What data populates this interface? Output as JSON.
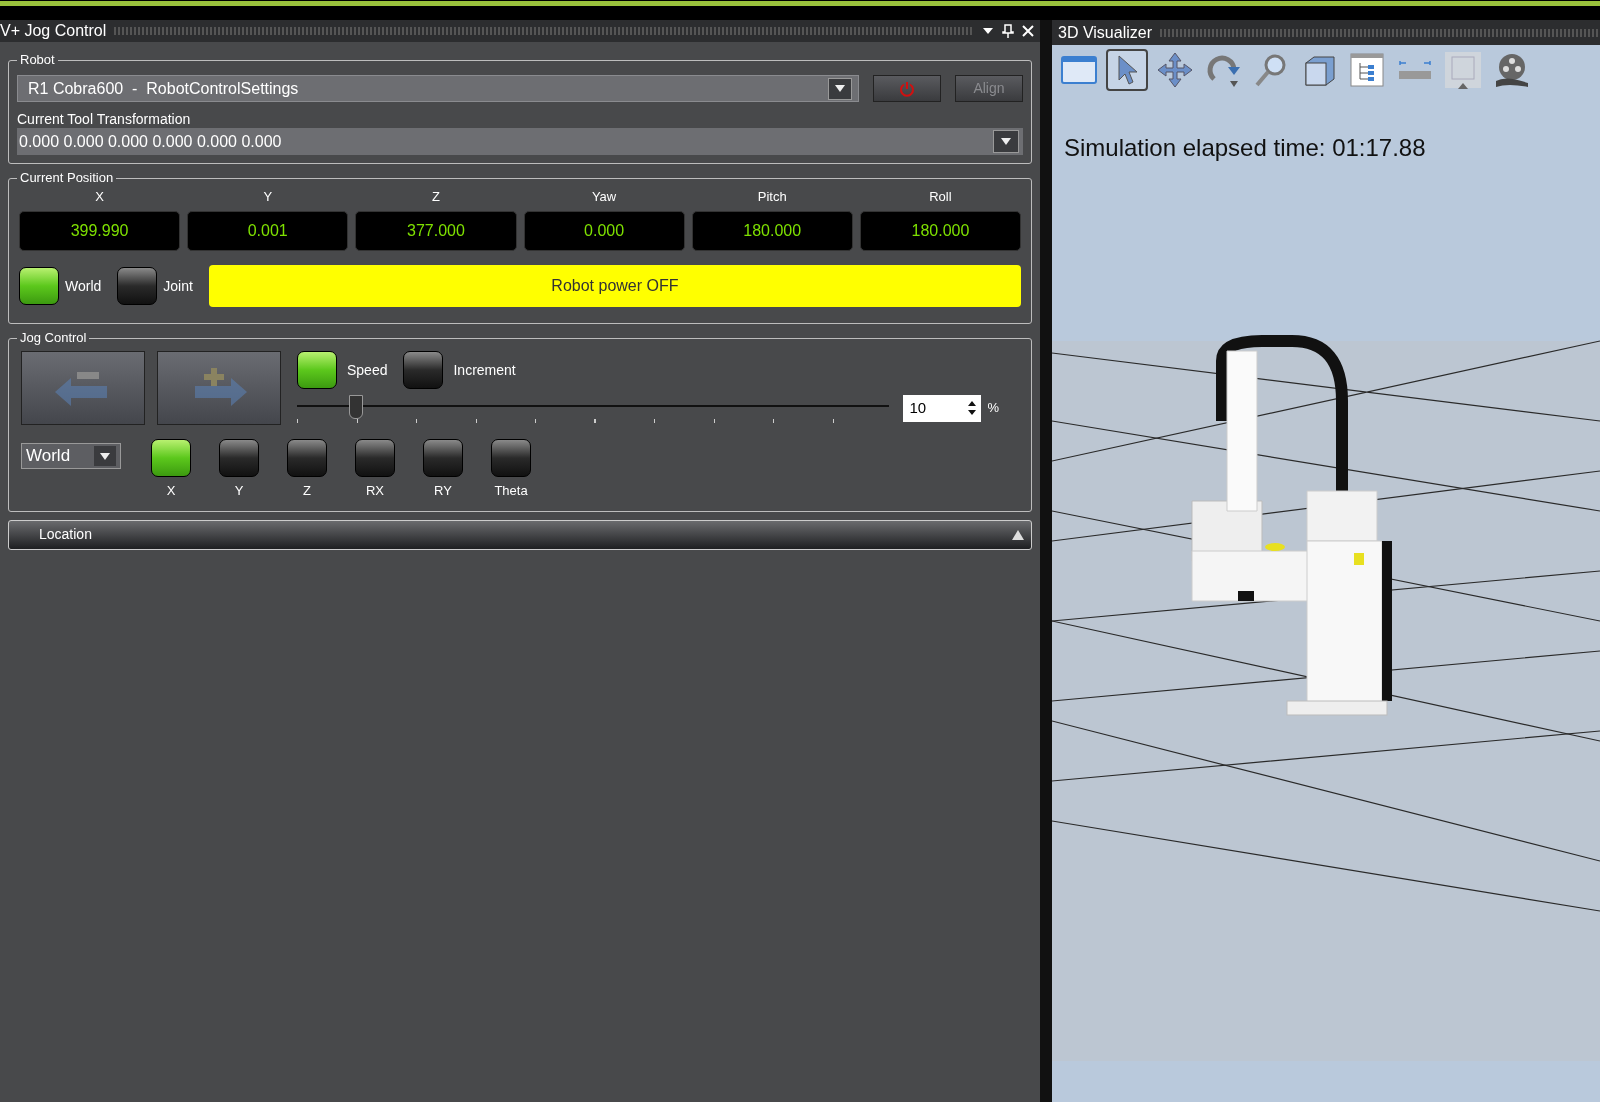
{
  "jog_panel": {
    "title": "V+ Jog Control",
    "robot": {
      "legend": "Robot",
      "selection": "R1 Cobra600  -  RobotControlSettings",
      "align_label": "Align",
      "align_disabled": true,
      "tool_label": "Current Tool Transformation",
      "tool_value": "0.000 0.000 0.000 0.000 0.000 0.000"
    },
    "position": {
      "legend": "Current Position",
      "coords": [
        {
          "label": "X",
          "value": "399.990"
        },
        {
          "label": "Y",
          "value": "0.001"
        },
        {
          "label": "Z",
          "value": "377.000"
        },
        {
          "label": "Yaw",
          "value": "0.000"
        },
        {
          "label": "Pitch",
          "value": "180.000"
        },
        {
          "label": "Roll",
          "value": "180.000"
        }
      ],
      "frames": [
        {
          "label": "World",
          "selected": true
        },
        {
          "label": "Joint",
          "selected": false
        }
      ],
      "status": "Robot power OFF"
    },
    "jog": {
      "legend": "Jog Control",
      "modes": [
        {
          "label": "Speed",
          "selected": true
        },
        {
          "label": "Increment",
          "selected": false
        }
      ],
      "speed": {
        "level": 0.1,
        "value": "10",
        "unit": "%"
      },
      "frame_select": "World",
      "axes": [
        {
          "label": "X",
          "selected": true
        },
        {
          "label": "Y",
          "selected": false
        },
        {
          "label": "Z",
          "selected": false
        },
        {
          "label": "RX",
          "selected": false
        },
        {
          "label": "RY",
          "selected": false
        },
        {
          "label": "Theta",
          "selected": false
        }
      ]
    },
    "location": {
      "label": "Location",
      "expanded": false
    }
  },
  "visualizer": {
    "title": "3D Visualizer",
    "toolbar": [
      {
        "kind": "window",
        "selected": false
      },
      {
        "kind": "pointer",
        "selected": true
      },
      {
        "kind": "move",
        "selected": false
      },
      {
        "kind": "rotate",
        "selected": false
      },
      {
        "kind": "zoom",
        "selected": false
      },
      {
        "kind": "cube",
        "selected": false
      },
      {
        "kind": "tree",
        "selected": false
      },
      {
        "kind": "ruler",
        "selected": false
      },
      {
        "kind": "frame",
        "selected": false
      },
      {
        "kind": "film",
        "selected": false
      }
    ],
    "elapsed": "Simulation elapsed time: 01:17.88"
  }
}
